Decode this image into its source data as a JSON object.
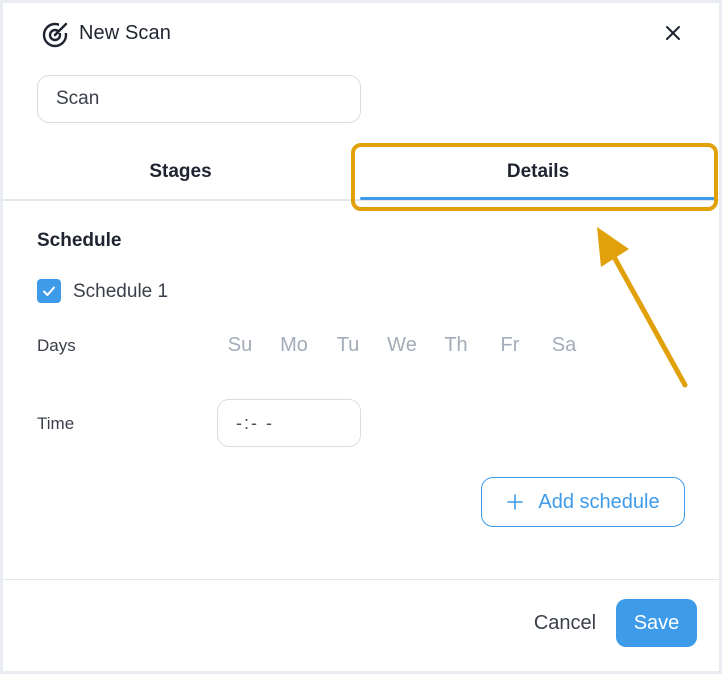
{
  "header": {
    "title": "New Scan",
    "logo_icon": "scan-radar-icon",
    "close_icon": "close-icon"
  },
  "name_input": {
    "value": "Scan"
  },
  "tabs": [
    {
      "label": "Stages",
      "active": false
    },
    {
      "label": "Details",
      "active": true
    }
  ],
  "schedule": {
    "section_title": "Schedule",
    "item": {
      "label": "Schedule 1",
      "checked": true
    },
    "days_label": "Days",
    "days": [
      "Su",
      "Mo",
      "Tu",
      "We",
      "Th",
      "Fr",
      "Sa"
    ],
    "time_label": "Time",
    "time_value": "-:- -",
    "add_label": "Add schedule"
  },
  "footer": {
    "cancel_label": "Cancel",
    "save_label": "Save"
  },
  "colors": {
    "accent": "#3d9be9",
    "highlight": "#e1a10a",
    "day_inactive": "#a3acb8"
  }
}
